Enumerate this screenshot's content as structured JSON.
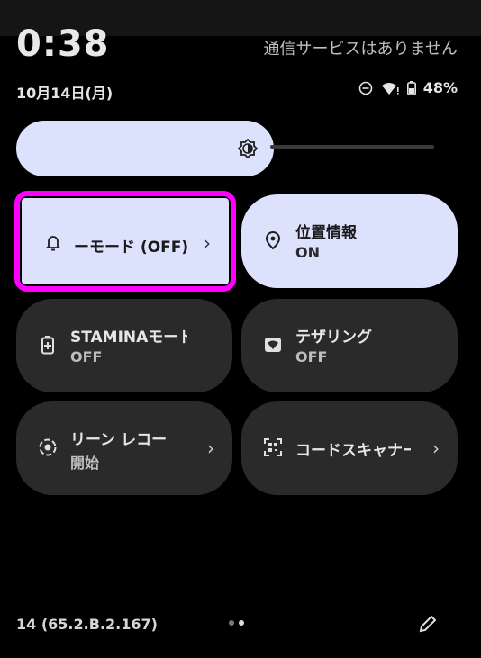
{
  "header": {
    "clock": "0:38",
    "carrier": "通信サービスはありません",
    "date": "10月14日(月)",
    "battery": "48%"
  },
  "tiles": [
    {
      "title": "ーモード (OFF)",
      "subtitle": "",
      "state": "on",
      "chevron": "›"
    },
    {
      "title": "位置情報",
      "subtitle": "ON",
      "state": "on"
    },
    {
      "title": "STAMINAモード",
      "subtitle": "OFF",
      "state": "off"
    },
    {
      "title": "テザリング",
      "subtitle": "OFF",
      "state": "off"
    },
    {
      "title": "リーン レコー",
      "subtitle": "開始",
      "state": "off",
      "chevron": "›"
    },
    {
      "title": "コードスキャナー",
      "subtitle": "",
      "state": "off",
      "chevron": "›"
    }
  ],
  "footer": {
    "build": "14 (65.2.B.2.167)"
  },
  "colors": {
    "active_tile": "#dce2fb",
    "inactive_tile": "#2a2a2a",
    "highlight": "#ff00ff"
  }
}
